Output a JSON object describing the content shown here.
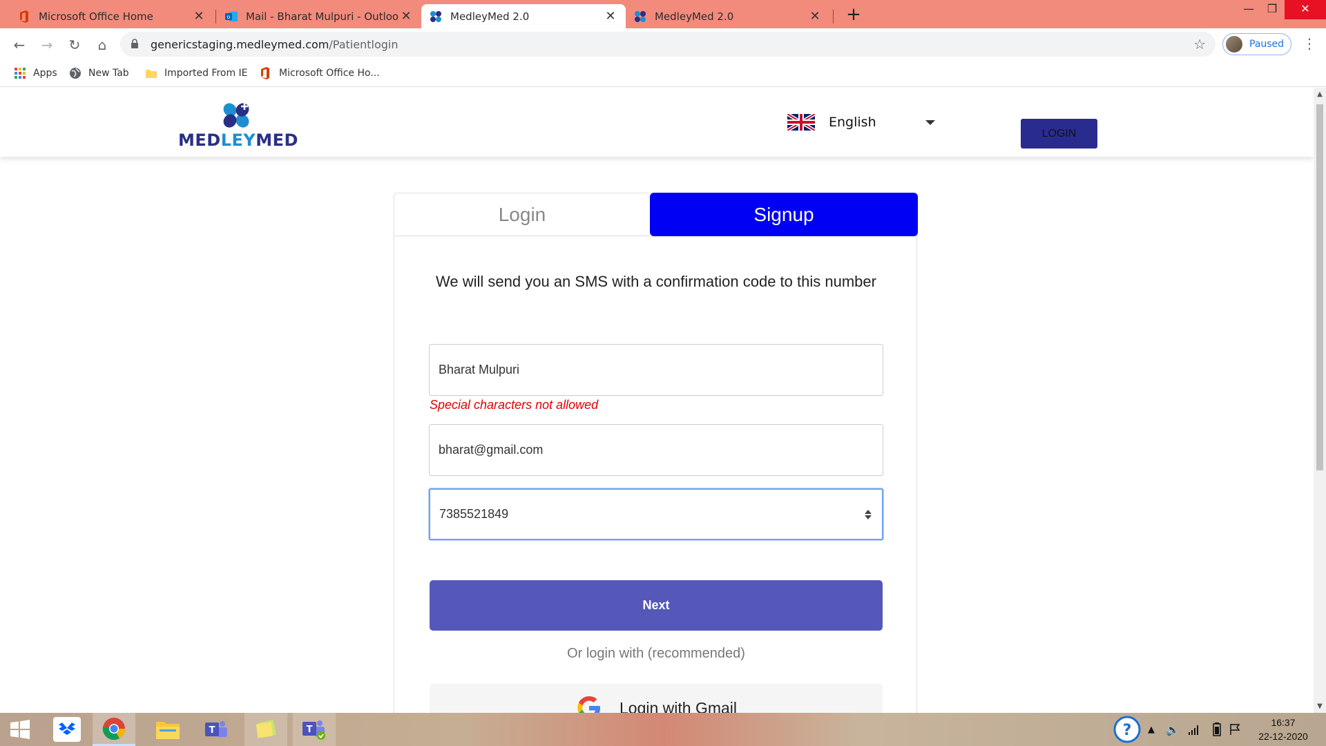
{
  "browser": {
    "tabs": [
      {
        "label": "Microsoft Office Home",
        "icon": "office-icon",
        "active": false
      },
      {
        "label": "Mail - Bharat Mulpuri - Outlook",
        "icon": "outlook-icon",
        "active": false
      },
      {
        "label": "MedleyMed 2.0",
        "icon": "medleymed-icon",
        "active": true
      },
      {
        "label": "MedleyMed 2.0",
        "icon": "medleymed-icon",
        "active": false
      }
    ],
    "new_tab": "+",
    "address": {
      "domain": "genericstaging.medleymed.com",
      "path": "/Patientlogin"
    },
    "profile_label": "Paused",
    "bookmarks": [
      {
        "label": "Apps",
        "icon": "apps-grid-icon"
      },
      {
        "label": "New Tab",
        "icon": "globe-icon"
      },
      {
        "label": "Imported From IE",
        "icon": "folder-icon"
      },
      {
        "label": "Microsoft Office Ho...",
        "icon": "office-icon"
      }
    ]
  },
  "site": {
    "logo_text_pre": "MED",
    "logo_text_mid": "LEY",
    "logo_text_post": "MED",
    "language": "English",
    "header_login_label": "LOGIN"
  },
  "auth": {
    "tab_login": "Login",
    "tab_signup": "Signup",
    "active_tab": "Signup",
    "sms_message": "We will send you an SMS with a confirmation code to this number",
    "name_value": "Bharat Mulpuri",
    "name_error": "Special characters not allowed",
    "email_value": "bharat@gmail.com",
    "phone_value": "7385521849",
    "next_label": "Next",
    "or_text": "Or login with (recommended)",
    "gmail_label": "Login with Gmail"
  },
  "taskbar": {
    "time": "16:37",
    "date": "22-12-2020",
    "apps": [
      "windows-start-icon",
      "dropbox-icon",
      "chrome-icon",
      "file-explorer-icon",
      "teams-icon",
      "sticky-notes-icon",
      "teams-icon"
    ]
  },
  "colors": {
    "tabbar": "#f28b7c",
    "signup_tab": "#0000f5",
    "next_button": "#5558b8",
    "error": "#e00000",
    "header_login": "#2a2b8f",
    "logo_navy": "#2a2f86",
    "logo_blue": "#1d8fd1"
  }
}
